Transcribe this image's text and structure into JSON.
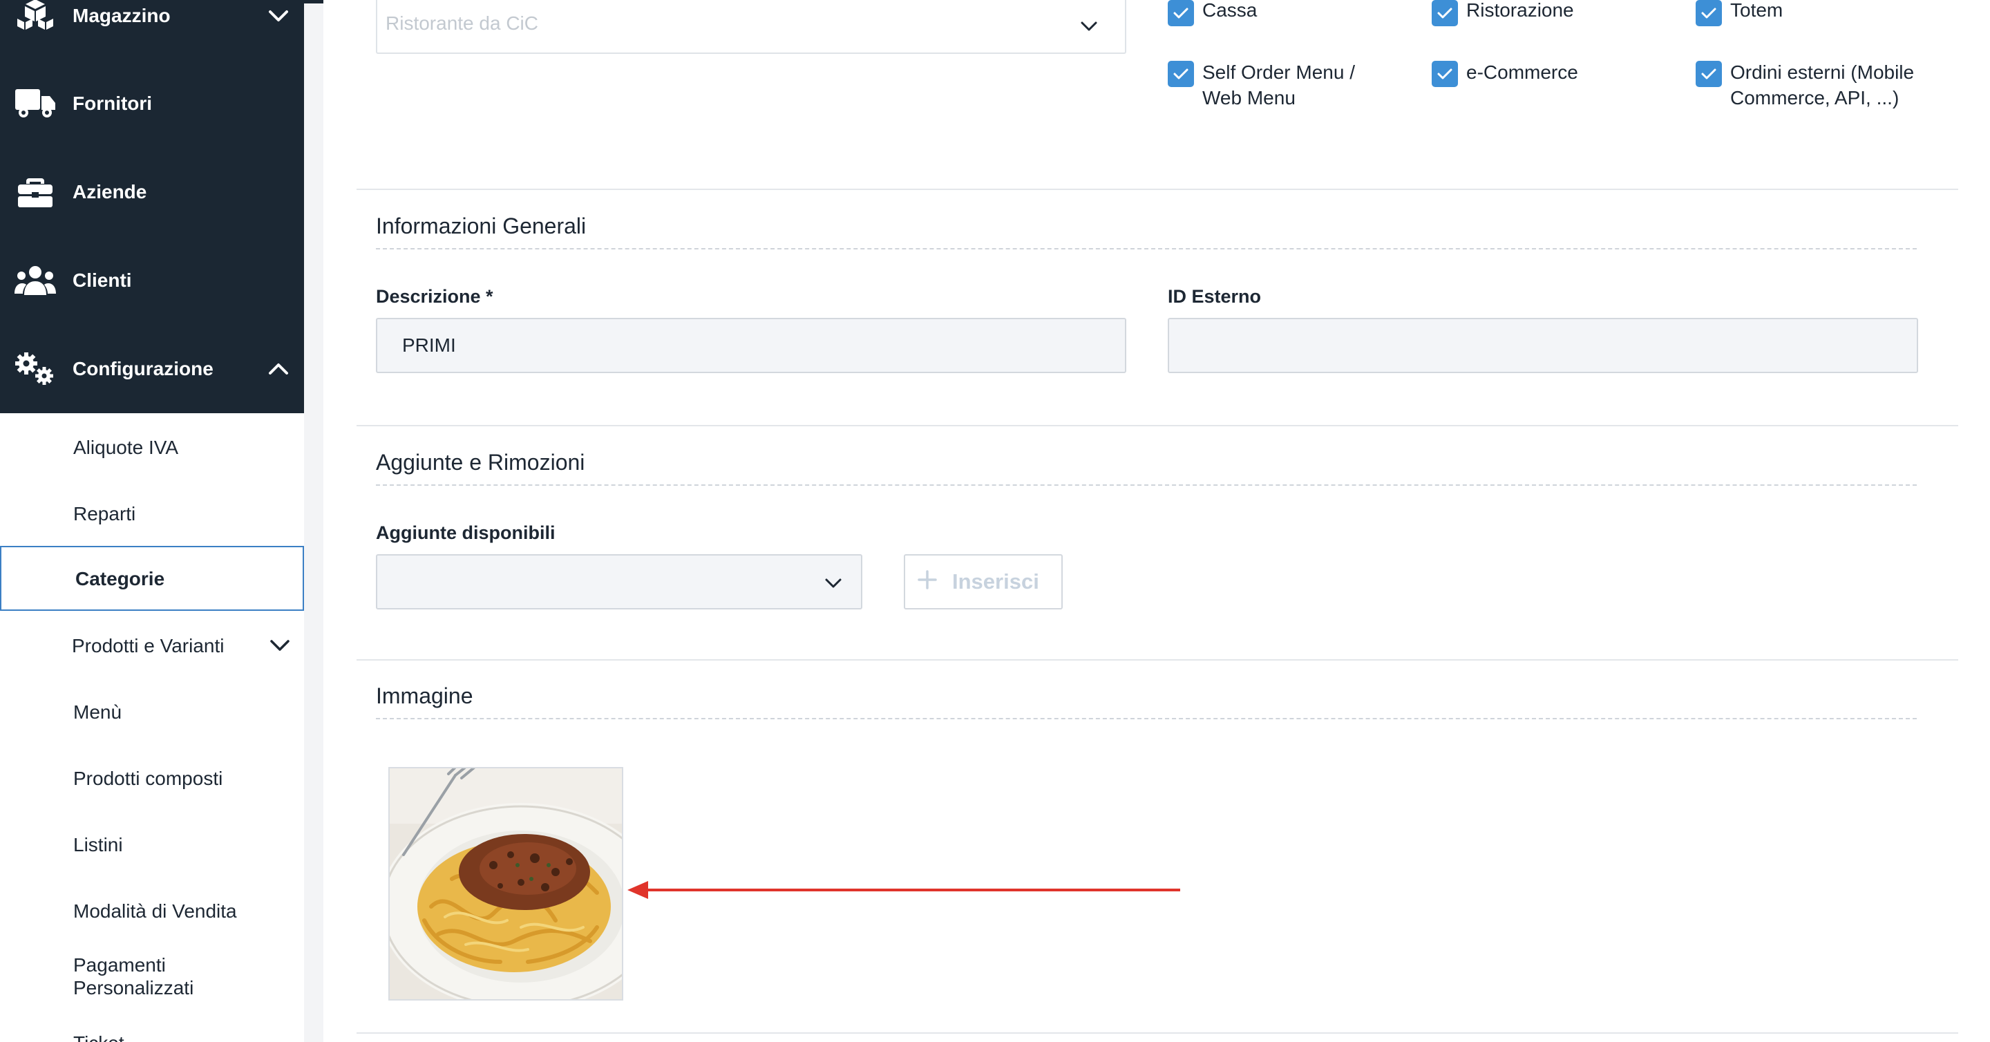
{
  "sidebar": {
    "main_items": [
      {
        "label": "Magazzino",
        "icon": "boxes-icon",
        "expanded": false
      },
      {
        "label": "Fornitori",
        "icon": "truck-icon"
      },
      {
        "label": "Aziende",
        "icon": "briefcase-icon"
      },
      {
        "label": "Clienti",
        "icon": "users-icon"
      },
      {
        "label": "Configurazione",
        "icon": "gears-icon",
        "expanded": true
      }
    ],
    "sub_items": [
      {
        "label": "Aliquote IVA"
      },
      {
        "label": "Reparti"
      },
      {
        "label": "Categorie",
        "active": true
      },
      {
        "label": "Prodotti e Varianti",
        "has_children": true
      },
      {
        "label": "Menù"
      },
      {
        "label": "Prodotti composti"
      },
      {
        "label": "Listini"
      },
      {
        "label": "Modalità di Vendita"
      },
      {
        "label": "Pagamenti Personalizzati"
      },
      {
        "label": "Ticket"
      }
    ]
  },
  "top_section": {
    "select_value": "Ristorante da CiC",
    "channels": [
      {
        "label": "Cassa",
        "checked": true
      },
      {
        "label": "Ristorazione",
        "checked": true
      },
      {
        "label": "Totem",
        "checked": true
      },
      {
        "label": "Self Order Menu / Web Menu",
        "checked": true
      },
      {
        "label": "e-Commerce",
        "checked": true
      },
      {
        "label": "Ordini esterni (Mobile Commerce, API, ...)",
        "checked": true
      }
    ]
  },
  "general_info": {
    "title": "Informazioni Generali",
    "description_label": "Descrizione *",
    "description_value": "PRIMI",
    "external_id_label": "ID Esterno",
    "external_id_value": ""
  },
  "additions": {
    "title": "Aggiunte e Rimozioni",
    "available_label": "Aggiunte disponibili",
    "available_value": "",
    "insert_button": "Inserisci"
  },
  "image_section": {
    "title": "Immagine"
  },
  "colors": {
    "sidebar_dark": "#1b2733",
    "checkbox_blue": "#3d8fd6",
    "annotation_red": "#e0342b",
    "active_border": "#3b7fc4"
  }
}
